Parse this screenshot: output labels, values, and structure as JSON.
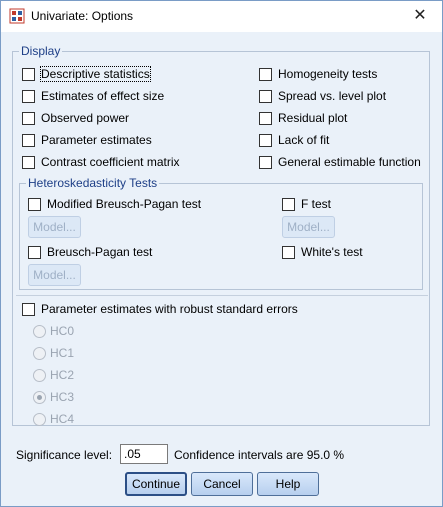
{
  "window": {
    "title": "Univariate: Options",
    "close_glyph": "✕"
  },
  "display": {
    "legend": "Display",
    "left": [
      {
        "label": "Descriptive statistics",
        "checked": false
      },
      {
        "label": "Estimates of effect size",
        "checked": false
      },
      {
        "label": "Observed power",
        "checked": false
      },
      {
        "label": "Parameter estimates",
        "checked": false
      },
      {
        "label": "Contrast coefficient matrix",
        "checked": false
      }
    ],
    "right": [
      {
        "label": "Homogeneity tests",
        "checked": false
      },
      {
        "label": "Spread vs. level plot",
        "checked": false
      },
      {
        "label": "Residual plot",
        "checked": false
      },
      {
        "label": "Lack of fit",
        "checked": false
      },
      {
        "label": "General estimable function",
        "checked": false
      }
    ]
  },
  "hetero": {
    "legend": "Heteroskedasticity Tests",
    "modified_bp": "Modified Breusch-Pagan test",
    "bp": "Breusch-Pagan test",
    "f_test": "F test",
    "whites": "White's test",
    "model_label": "Model..."
  },
  "robust": {
    "label": "Parameter estimates with robust standard errors",
    "options": [
      "HC0",
      "HC1",
      "HC2",
      "HC3",
      "HC4"
    ],
    "selected": "HC3"
  },
  "significance": {
    "label": "Significance level:",
    "value": ".05"
  },
  "confidence_text": "Confidence intervals are 95.0 %",
  "buttons": {
    "continue": "Continue",
    "cancel": "Cancel",
    "help": "Help"
  },
  "colors": {
    "group_legend": "#1e3f87",
    "background": "#eaf1f9"
  }
}
